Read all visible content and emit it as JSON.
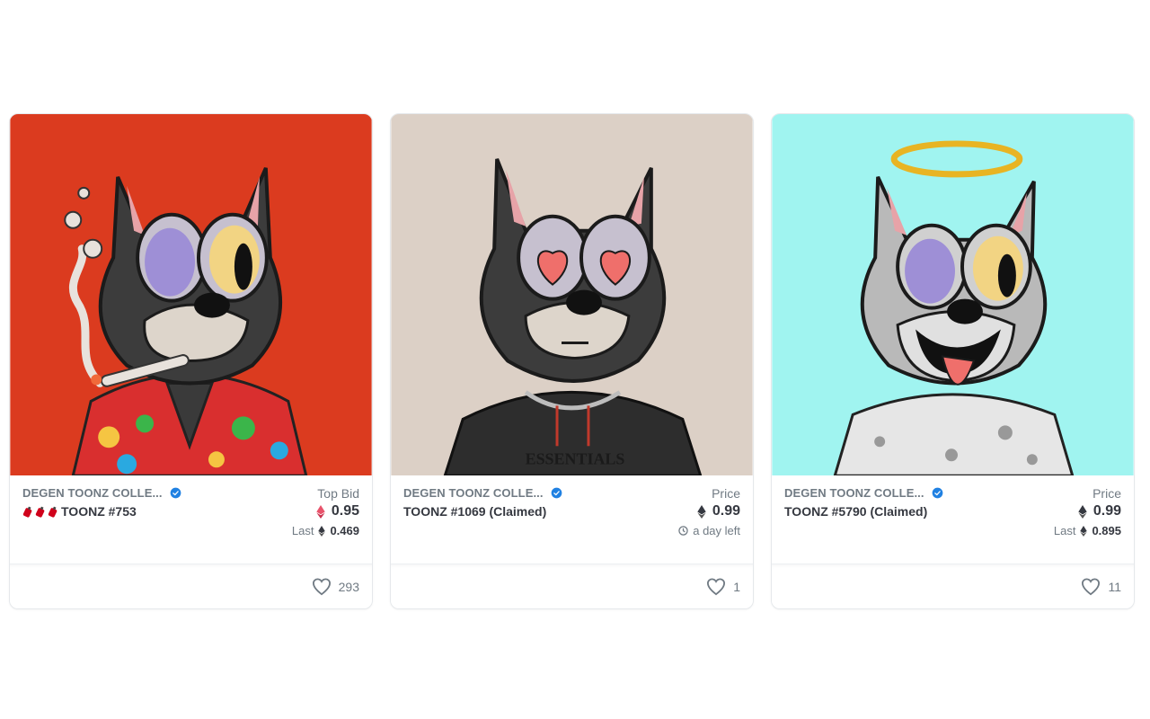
{
  "colors": {
    "card1_bg": "#db3b1f",
    "card2_bg": "#dcd0c6",
    "card3_bg": "#a0f4f0",
    "verified_blue": "#2081e2",
    "text_dark": "#353840",
    "text_muted": "#707a83",
    "eth_red": "#e8536b"
  },
  "cards": [
    {
      "collection": "DEGEN TOONZ COLLE...",
      "name": "TOONZ #753",
      "prefix_icon": "fire-extinguisher-emoji-icon",
      "price_label": "Top Bid",
      "price": "0.95",
      "price_icon": "weth-icon",
      "sub_label": "Last",
      "sub_value": "0.469",
      "favorites": "293",
      "art": "cat-smoking-hawaiian-shirt"
    },
    {
      "collection": "DEGEN TOONZ COLLE...",
      "name": "TOONZ #1069 (Claimed)",
      "price_label": "Price",
      "price": "0.99",
      "price_icon": "eth-icon",
      "sub_label": "a day left",
      "sub_value": "",
      "favorites": "1",
      "art": "cat-heart-eyes-black-hoodie",
      "hoodie_text": "ESSENTIALS"
    },
    {
      "collection": "DEGEN TOONZ COLLE...",
      "name": "TOONZ #5790 (Claimed)",
      "price_label": "Price",
      "price": "0.99",
      "price_icon": "eth-icon",
      "sub_label": "Last",
      "sub_value": "0.895",
      "favorites": "11",
      "art": "cat-halo-tongue-white-shirt"
    }
  ]
}
